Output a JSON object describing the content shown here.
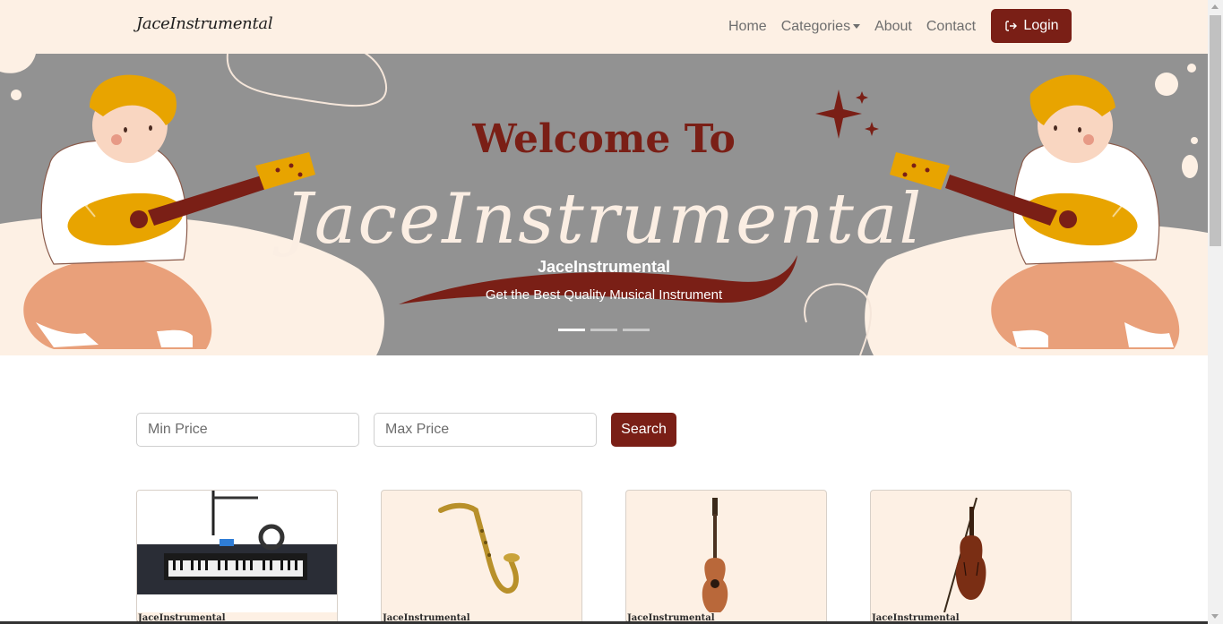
{
  "navbar": {
    "brand": "JaceInstrumental",
    "links": [
      "Home",
      "Categories",
      "About",
      "Contact"
    ],
    "login_label": "Login",
    "icons": {
      "login": "login-icon",
      "categories": "caret-down-icon"
    }
  },
  "hero": {
    "title": "Welcome To",
    "script": "JaceInstrumental",
    "caption_title": "JaceInstrumental",
    "caption_text": "Get the Best Quality Musical Instrument",
    "indicators": 3,
    "active_indicator": 0
  },
  "search": {
    "min_placeholder": "Min Price",
    "max_placeholder": "Max Price",
    "button_label": "Search"
  },
  "products": [
    {
      "image": "keyboard-setup",
      "label": "JaceInstrumental"
    },
    {
      "image": "saxophone",
      "label": "JaceInstrumental"
    },
    {
      "image": "acoustic-guitar",
      "label": "JaceInstrumental"
    },
    {
      "image": "violin",
      "label": "JaceInstrumental"
    }
  ],
  "colors": {
    "accent": "#7a1f16",
    "navbar_bg": "#fdf0e4",
    "hero_bg": "#929292",
    "card_bg": "#fdf0e4",
    "hair": "#e8a400"
  }
}
